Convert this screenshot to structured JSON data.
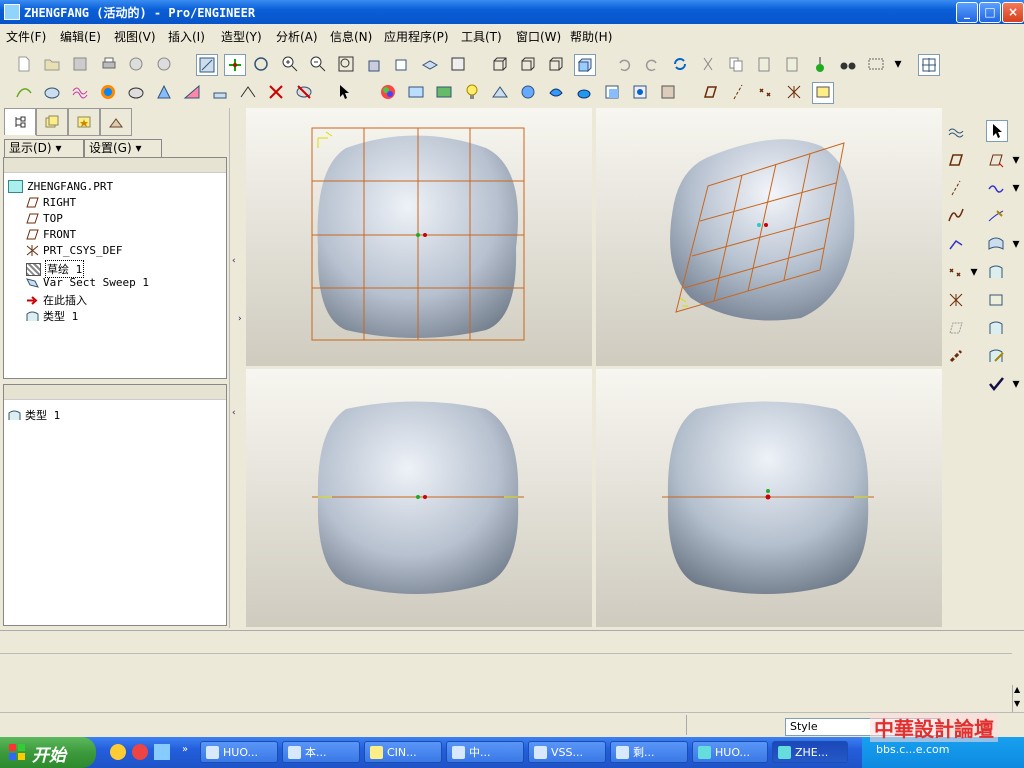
{
  "window": {
    "title": "ZHENGFANG (活动的) - Pro/ENGINEER",
    "controls": {
      "minimize": "_",
      "maximize": "□",
      "close": "×"
    }
  },
  "menu": [
    "文件(F)",
    "编辑(E)",
    "视图(V)",
    "插入(I)",
    "造型(Y)",
    "分析(A)",
    "信息(N)",
    "应用程序(P)",
    "工具(T)",
    "窗口(W)",
    "帮助(H)"
  ],
  "left_panel": {
    "display_button": "显示(D)",
    "settings_button": "设置(G)",
    "tree": [
      {
        "label": "ZHENGFANG.PRT",
        "icon": "part-icon"
      },
      {
        "label": "RIGHT",
        "icon": "datum-plane-icon"
      },
      {
        "label": "TOP",
        "icon": "datum-plane-icon"
      },
      {
        "label": "FRONT",
        "icon": "datum-plane-icon"
      },
      {
        "label": "PRT_CSYS_DEF",
        "icon": "csys-icon"
      },
      {
        "label": "草绘 1",
        "icon": "sketch-icon"
      },
      {
        "label": "Var Sect Sweep 1",
        "icon": "sweep-icon"
      },
      {
        "label": "在此插入",
        "icon": "insert-here-arrow-icon"
      },
      {
        "label": "类型 1",
        "icon": "style-feature-icon"
      }
    ],
    "lower_tree": [
      {
        "label": "类型 1",
        "icon": "style-feature-icon"
      }
    ]
  },
  "status": {
    "filter_value": "Style"
  },
  "taskbar": {
    "start_label": "开始",
    "tasks": [
      {
        "label": "HUO..."
      },
      {
        "label": "本..."
      },
      {
        "label": "CIN..."
      },
      {
        "label": "中..."
      },
      {
        "label": "VSS..."
      },
      {
        "label": "剩..."
      },
      {
        "label": "HUO..."
      },
      {
        "label": "ZHE...",
        "active": true
      }
    ],
    "watermark_text": "中華設計論壇",
    "watermark_url": "bbs.c...e.com"
  },
  "colors": {
    "title_blue": "#0a5fd8",
    "grid_orange": "#c8671e",
    "model_blue": "#a9b6c8",
    "taskbar_blue": "#245edb"
  }
}
